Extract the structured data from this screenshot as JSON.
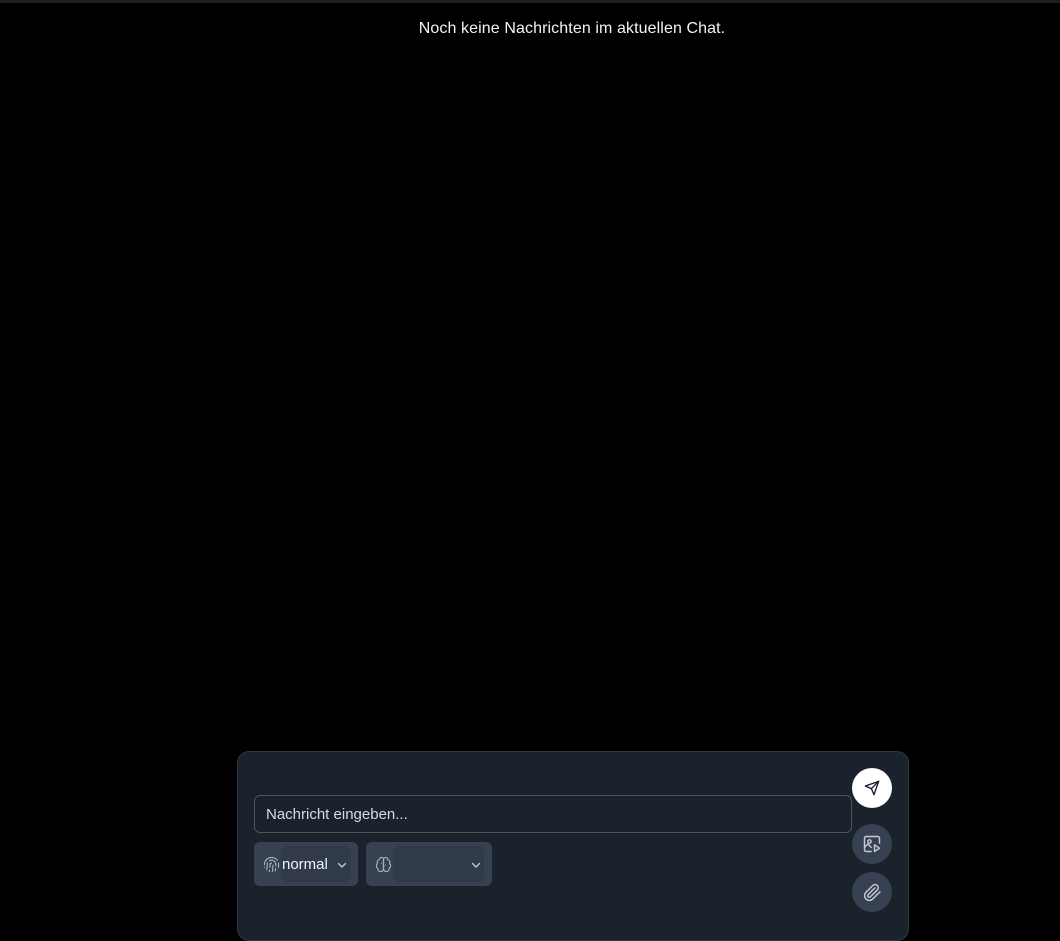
{
  "chat": {
    "empty_message": "Noch keine Nachrichten im aktuellen Chat."
  },
  "composer": {
    "input_placeholder": "Nachricht eingeben...",
    "input_value": "",
    "mode_select": {
      "icon": "fingerprint-icon",
      "value": "normal"
    },
    "model_select": {
      "icon": "brain-icon",
      "value": ""
    },
    "buttons": {
      "send": {
        "icon": "send-icon"
      },
      "image": {
        "icon": "image-icon"
      },
      "attach": {
        "icon": "paperclip-icon"
      }
    }
  },
  "colors": {
    "background": "#000000",
    "composer_bg": "#1a222c",
    "select_bg": "#374151",
    "send_button_bg": "#ffffff"
  }
}
